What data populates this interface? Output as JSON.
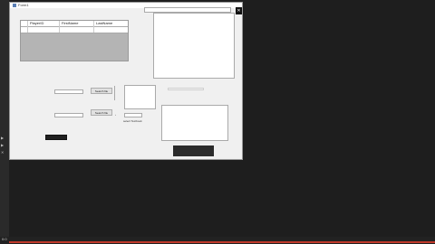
{
  "window": {
    "title": "Form1"
  },
  "grid": {
    "columns": [
      "PlayerID",
      "FirstName",
      "LastName"
    ]
  },
  "buttons": {
    "search_file": "Search file",
    "search_file2": "Search file",
    "select_textbook": "select Textbook"
  },
  "taskbar": {
    "label": "0:0"
  },
  "topbar": {
    "text": ""
  },
  "strip_glyphs": [
    "▶",
    "▶",
    "✕"
  ]
}
